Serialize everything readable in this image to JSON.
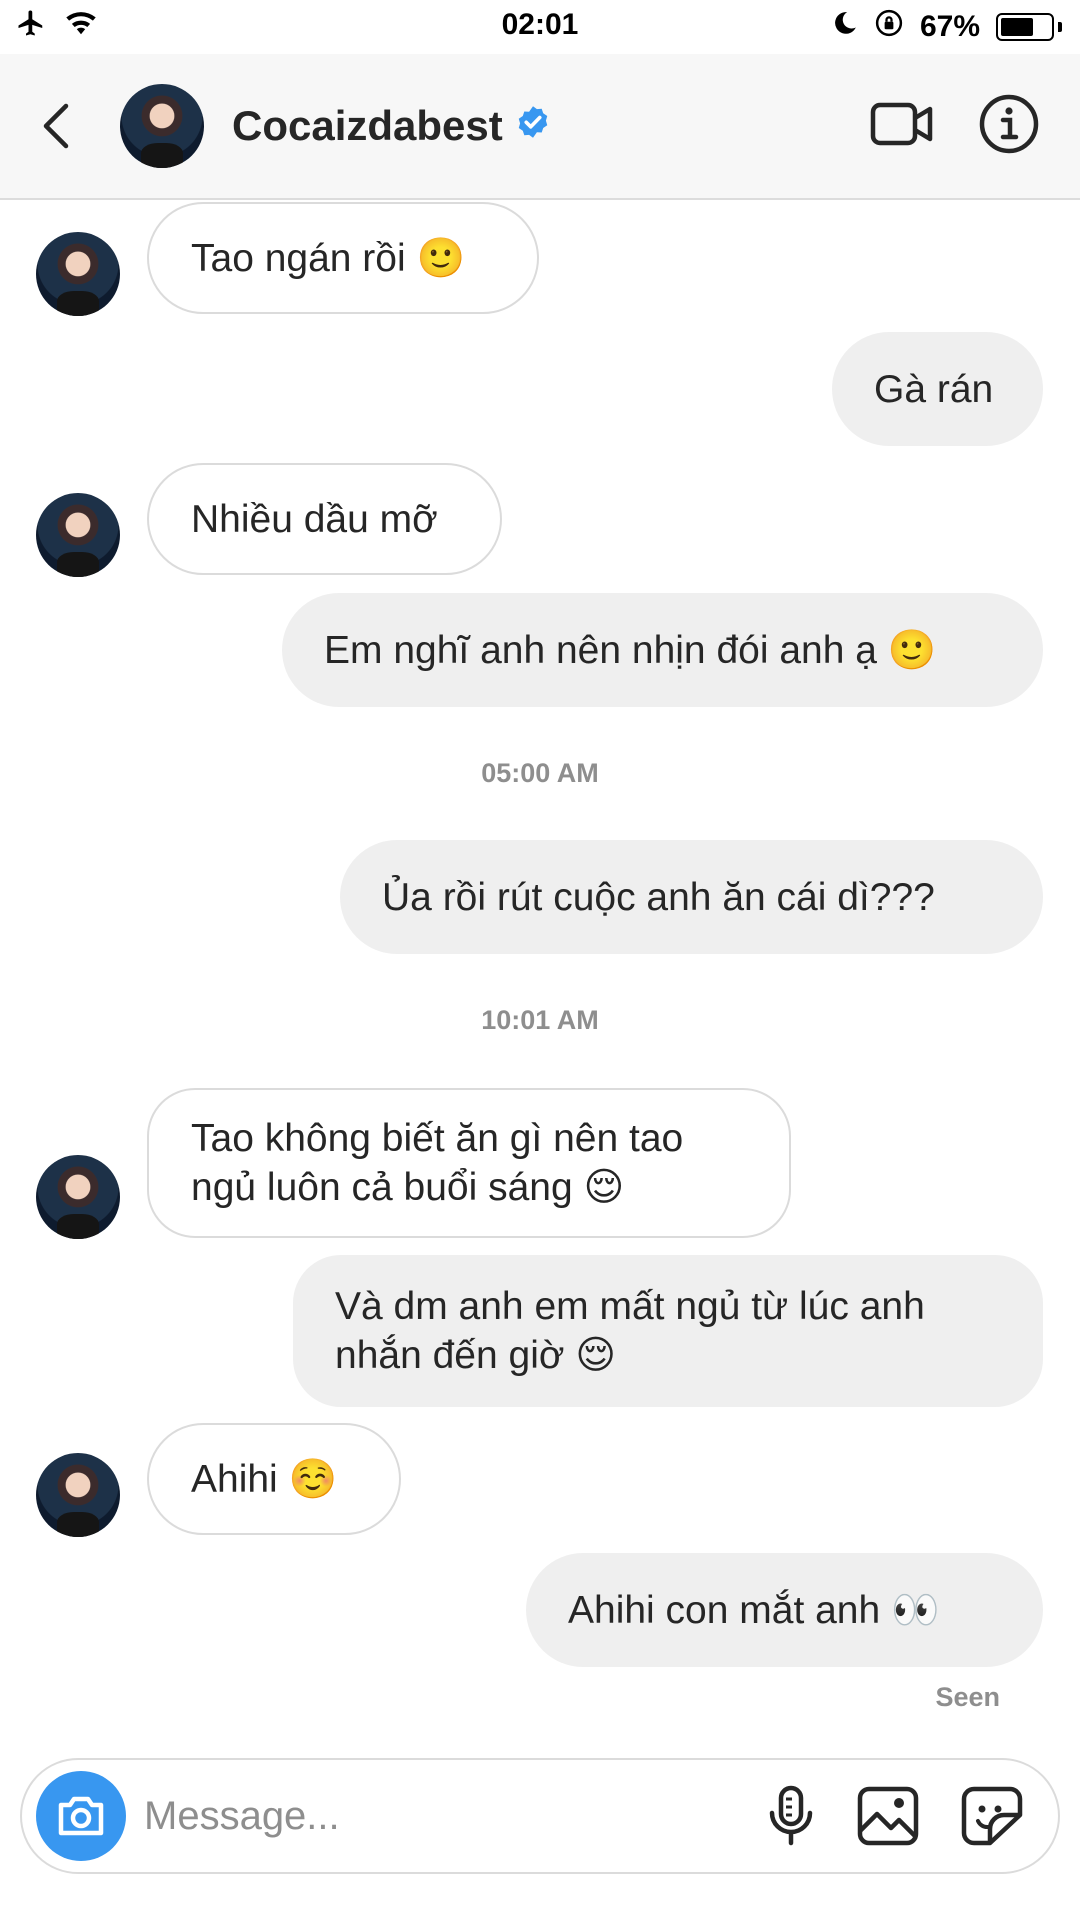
{
  "status_bar": {
    "time": "02:01",
    "battery_percent": "67%",
    "battery_level": 0.67
  },
  "header": {
    "username": "Cocaizdabest",
    "verified": true
  },
  "messages": [
    {
      "sender": "them",
      "text": "Tao ngán rồi 🙂"
    },
    {
      "sender": "me",
      "text": "Gà rán"
    },
    {
      "sender": "them",
      "text": "Nhiều dầu mỡ"
    },
    {
      "sender": "me",
      "text": "Em nghĩ anh nên nhịn đói anh ạ 🙂"
    },
    {
      "timestamp": "05:00 AM"
    },
    {
      "sender": "me",
      "text": "Ủa rồi rút cuộc anh ăn cái dì???"
    },
    {
      "timestamp": "10:01 AM"
    },
    {
      "sender": "them",
      "lines": [
        "Tao không biết ăn gì nên tao",
        "ngủ luôn cả buổi sáng 😌"
      ]
    },
    {
      "sender": "me",
      "lines": [
        "Và dm anh em mất ngủ từ lúc anh",
        "nhắn đến giờ 😌"
      ]
    },
    {
      "sender": "them",
      "text": "Ahihi ☺️"
    },
    {
      "sender": "me",
      "text": "Ahihi con mắt anh 👀"
    }
  ],
  "seen_label": "Seen",
  "composer": {
    "placeholder": "Message..."
  },
  "colors": {
    "accent": "#3897f0",
    "outgoing_bubble": "#efefef",
    "incoming_border": "#dbdbdb",
    "secondary_text": "#8e8e8e"
  }
}
